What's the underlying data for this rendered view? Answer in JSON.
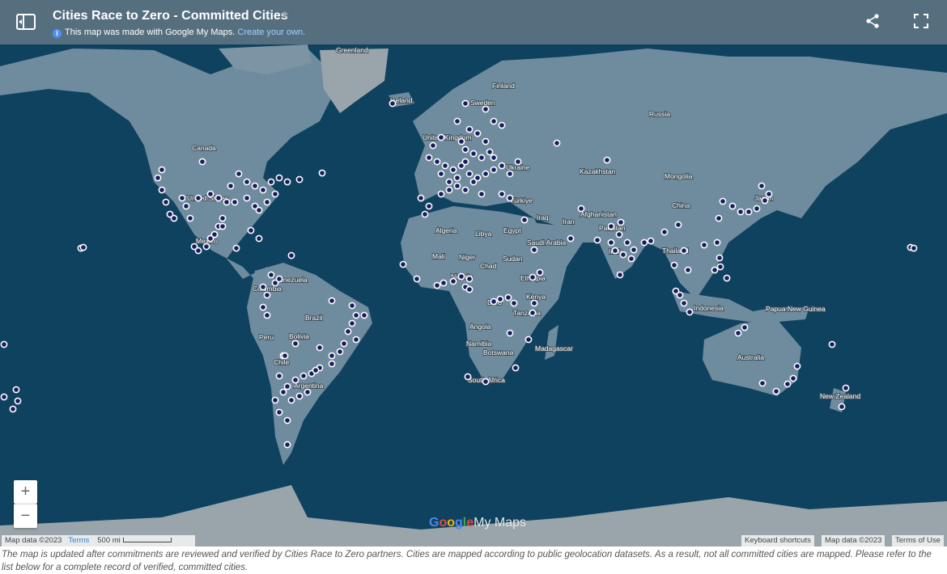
{
  "header": {
    "title": "Cities Race to Zero - Committed Cities",
    "made_with": "This map was made with Google My Maps.",
    "create_link": "Create your own."
  },
  "map": {
    "colors": {
      "ocean": "#0f425f",
      "land": "#6f8c9e",
      "land_dark": "#566f7f",
      "ice": "#9aa5ab",
      "marker": "#1a1d5c"
    },
    "labels": [
      {
        "text": "Greenland"
      },
      {
        "text": "Iceland"
      },
      {
        "text": "Finland"
      },
      {
        "text": "Sweden"
      },
      {
        "text": "Russia"
      },
      {
        "text": "Canada"
      },
      {
        "text": "United Kingdom"
      },
      {
        "text": "Ukraine"
      },
      {
        "text": "Kazakhstan"
      },
      {
        "text": "Mongolia"
      },
      {
        "text": "United States"
      },
      {
        "text": "Türkiye"
      },
      {
        "text": "China"
      },
      {
        "text": "Japan"
      },
      {
        "text": "Iraq"
      },
      {
        "text": "Iran"
      },
      {
        "text": "Afghanistan"
      },
      {
        "text": "Algeria"
      },
      {
        "text": "Libya"
      },
      {
        "text": "Egypt"
      },
      {
        "text": "Pakistan"
      },
      {
        "text": "Mexico"
      },
      {
        "text": "Saudi Arabia"
      },
      {
        "text": "India"
      },
      {
        "text": "Mali"
      },
      {
        "text": "Niger"
      },
      {
        "text": "Sudan"
      },
      {
        "text": "Chad"
      },
      {
        "text": "Thailand"
      },
      {
        "text": "Venezuela"
      },
      {
        "text": "Nigeria"
      },
      {
        "text": "Ethiopia"
      },
      {
        "text": "Colombia"
      },
      {
        "text": "Kenya"
      },
      {
        "text": "DRC"
      },
      {
        "text": "Indonesia"
      },
      {
        "text": "Tanzania"
      },
      {
        "text": "Papua New Guinea"
      },
      {
        "text": "Brazil"
      },
      {
        "text": "Peru"
      },
      {
        "text": "Angola"
      },
      {
        "text": "Madagascar"
      },
      {
        "text": "Namibia"
      },
      {
        "text": "Bolivia"
      },
      {
        "text": "Australia"
      },
      {
        "text": "Botswana"
      },
      {
        "text": "Chile"
      },
      {
        "text": "South Africa"
      },
      {
        "text": "Argentina"
      },
      {
        "text": "New Zealand"
      }
    ]
  },
  "controls": {
    "zoom_in": "+",
    "zoom_out": "−"
  },
  "logo": {
    "google": [
      "G",
      "o",
      "o",
      "g",
      "l",
      "e"
    ],
    "my_maps": "My Maps"
  },
  "attribution": {
    "map_data": "Map data ©2023",
    "terms": "Terms",
    "scale": "500 mi",
    "keyboard_shortcuts": "Keyboard shortcuts",
    "map_data_right": "Map data ©2023",
    "terms_of_use": "Terms of Use"
  },
  "caption": "The map is updated after commitments are reviewed and verified by Cities Race to Zero partners. Cities are mapped according to public geolocation datasets. As a result, not all committed cities are mapped. Please refer to the list below for a complete record of verified, committed cities."
}
